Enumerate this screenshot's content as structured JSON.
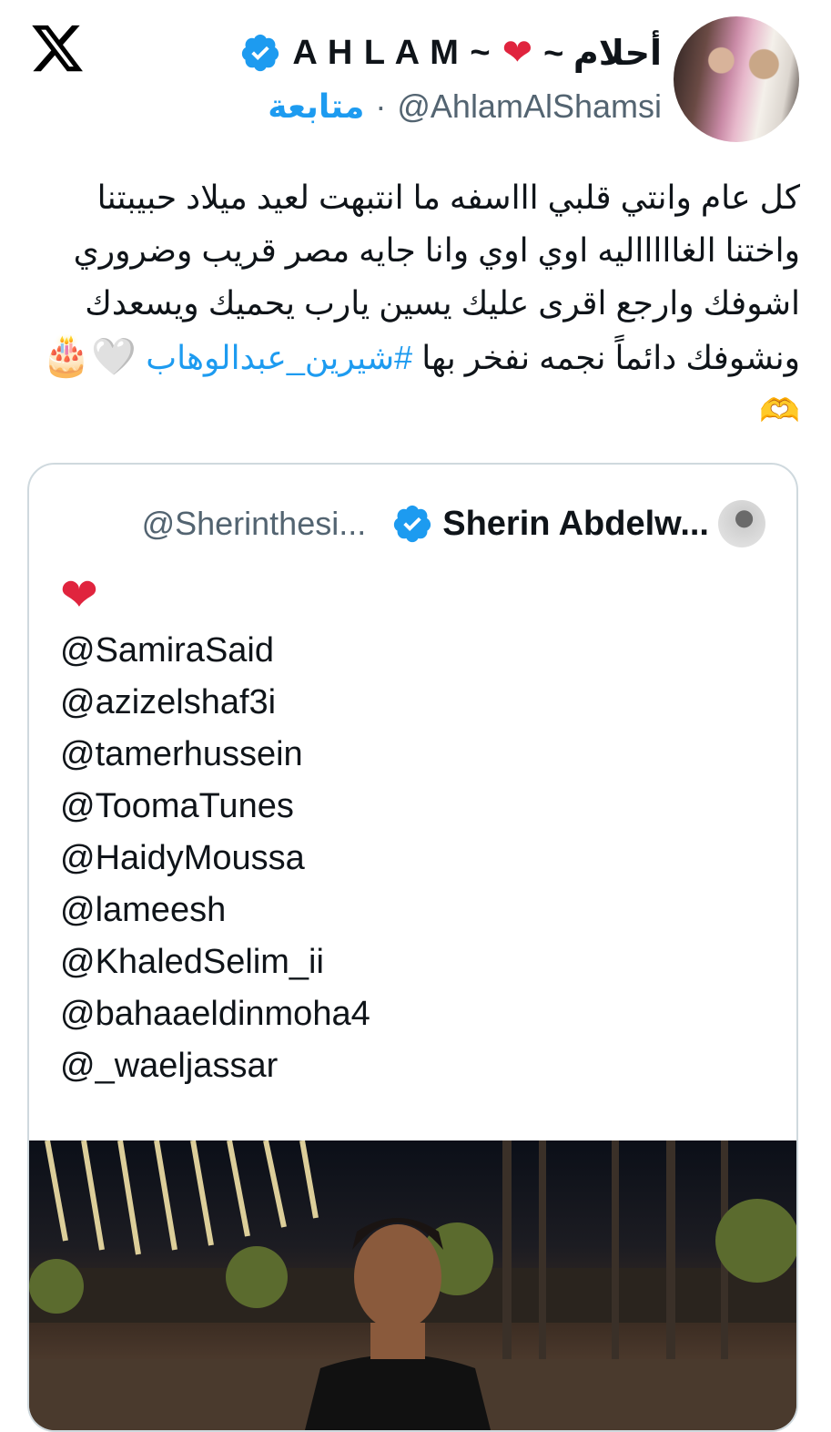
{
  "author": {
    "display_name": "A H L A M ~",
    "heart": "❤",
    "display_name_arabic": "~ أحلام",
    "handle": "@AhlamAlShamsi",
    "separator": "·",
    "follow_label": "متابعة"
  },
  "tweet": {
    "text_main": "كل عام وانتي قلبي اااسفه ما انتبهت لعيد ميلاد حبيبتنا واختنا الغاااااليه اوي اوي وانا جايه مصر قريب وضروري اشوفك وارجع اقرى عليك يسين يارب يحميك ويسعدك ونشوفك دائماً نجمه نفخر بها ",
    "hashtag": "#شيرين_عبدالوهاب",
    "emoji_white_heart": "🤍",
    "emoji_cake": "🎂",
    "emoji_heart_hands": "🫶"
  },
  "quoted": {
    "display_name": "Sherin Abdelw...",
    "handle": "@Sherinthesi...",
    "heart": "❤",
    "mentions": [
      "@SamiraSaid",
      "@azizelshaf3i",
      "@tamerhussein",
      "@ToomaTunes",
      "@HaidyMoussa",
      "@lameesh",
      "@KhaledSelim_ii",
      "@bahaaeldinmoha4",
      "@_waeljassar"
    ]
  },
  "icons": {
    "logo": "x-logo-icon",
    "verified": "verified-badge-icon"
  },
  "colors": {
    "accent_blue": "#1d9bf0",
    "heart_red": "#e0243e",
    "muted_gray": "#536471",
    "border": "#cfd9de"
  }
}
